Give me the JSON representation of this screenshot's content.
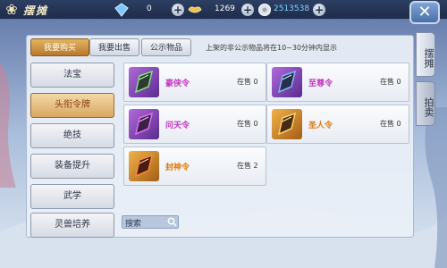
{
  "header": {
    "title": "摆摊",
    "diamond_value": "0",
    "gold_value": "1269",
    "silver_value": "2513538"
  },
  "tabs": [
    {
      "label": "我要购买"
    },
    {
      "label": "我要出售"
    },
    {
      "label": "公示物品"
    }
  ],
  "notice": "上架的非公示物品将在10~30分钟内显示",
  "side_tabs": [
    {
      "label": "摆摊"
    },
    {
      "label": "拍卖"
    }
  ],
  "categories": [
    {
      "label": "法宝"
    },
    {
      "label": "头衔令牌"
    },
    {
      "label": "绝技"
    },
    {
      "label": "装备提升"
    },
    {
      "label": "武学"
    },
    {
      "label": "灵兽培养"
    }
  ],
  "items": [
    {
      "name": "豪侠令",
      "stock": "在售 0",
      "color": "#c334c4"
    },
    {
      "name": "至尊令",
      "stock": "在售 0",
      "color": "#c334c4"
    },
    {
      "name": "问天令",
      "stock": "在售 0",
      "color": "#c334c4"
    },
    {
      "name": "圣人令",
      "stock": "在售 0",
      "color": "#e0790e"
    },
    {
      "name": "封神令",
      "stock": "在售 2",
      "color": "#e0790e"
    }
  ],
  "search": {
    "label": "搜索"
  },
  "colors": {
    "accent_orange": "#d8a761",
    "topbar": "#1f2c49"
  }
}
